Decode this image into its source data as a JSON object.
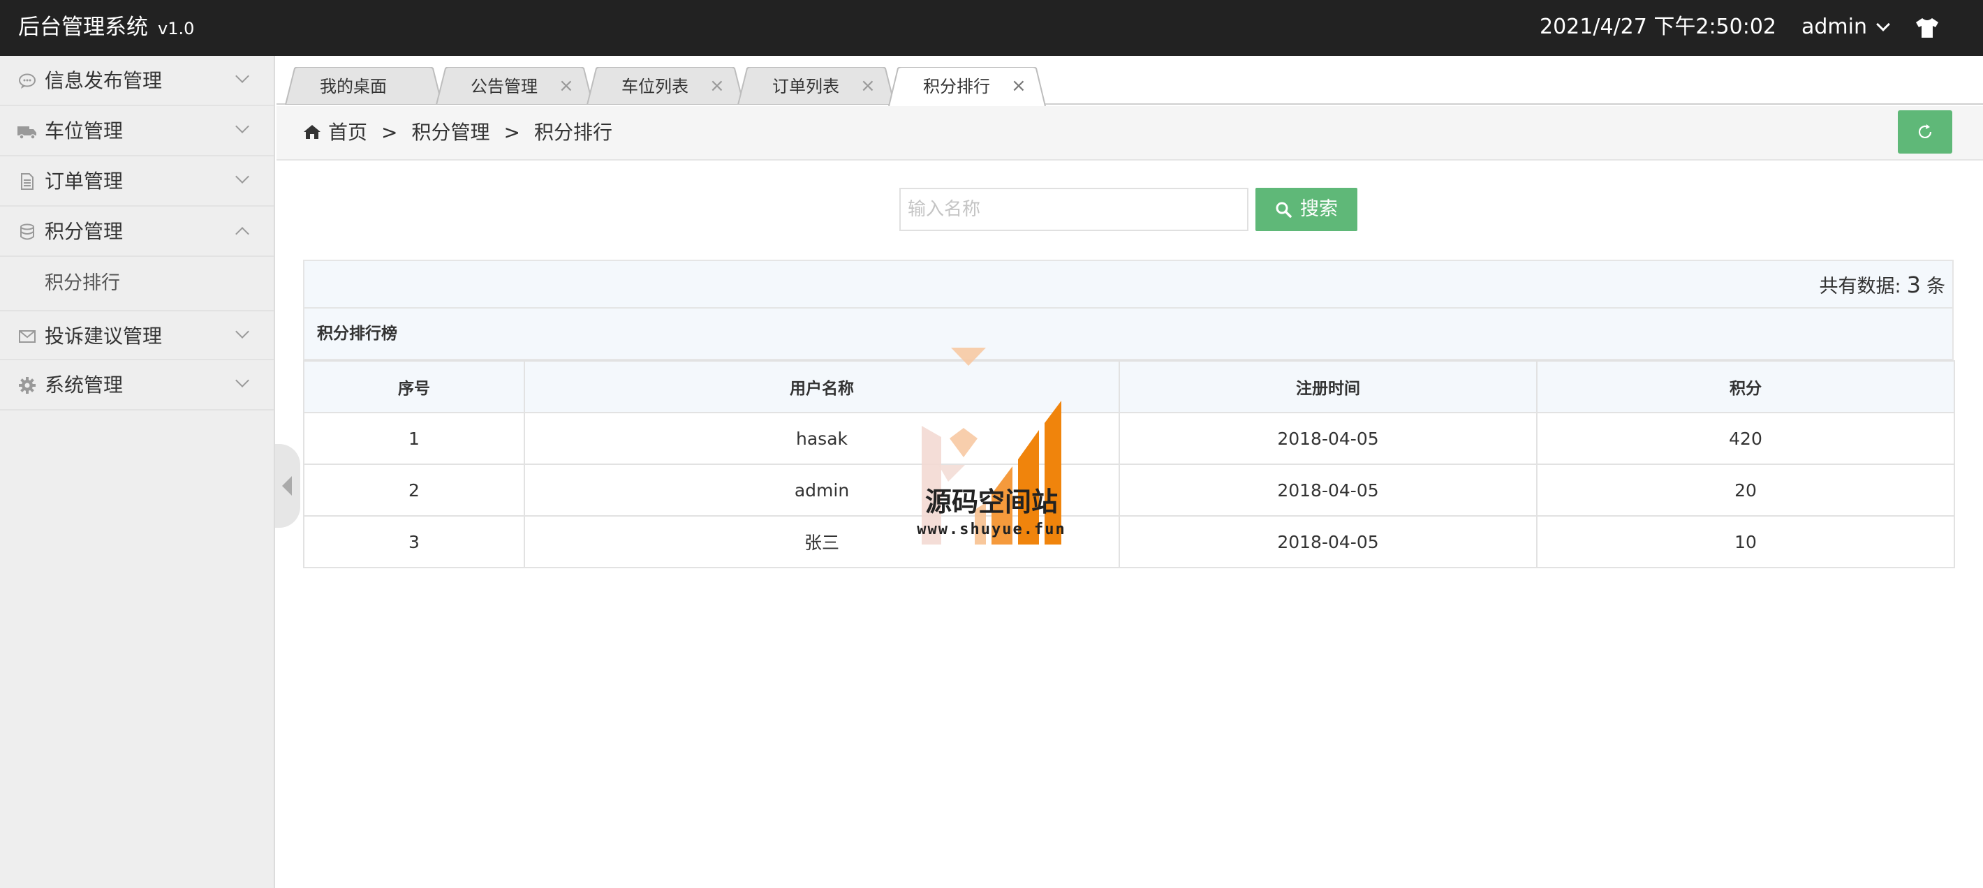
{
  "header": {
    "app_title": "后台管理系统",
    "version": "v1.0",
    "datetime": "2021/4/27 下午2:50:02",
    "user": "admin",
    "theme_icon": "shirt-icon"
  },
  "sidebar": {
    "items": [
      {
        "label": "信息发布管理",
        "icon": "chat-bubble-icon",
        "expanded": false
      },
      {
        "label": "车位管理",
        "icon": "truck-icon",
        "expanded": false
      },
      {
        "label": "订单管理",
        "icon": "document-icon",
        "expanded": false
      },
      {
        "label": "积分管理",
        "icon": "database-icon",
        "expanded": true,
        "children": [
          {
            "label": "积分排行"
          }
        ]
      },
      {
        "label": "投诉建议管理",
        "icon": "envelope-icon",
        "expanded": false
      },
      {
        "label": "系统管理",
        "icon": "gear-icon",
        "expanded": false
      }
    ]
  },
  "tabs": [
    {
      "label": "我的桌面",
      "closable": false
    },
    {
      "label": "公告管理",
      "closable": true
    },
    {
      "label": "车位列表",
      "closable": true
    },
    {
      "label": "订单列表",
      "closable": true
    },
    {
      "label": "积分排行",
      "closable": true,
      "active": true
    }
  ],
  "breadcrumb": {
    "items": [
      "首页",
      "积分管理",
      "积分排行"
    ],
    "separator": ">"
  },
  "search": {
    "placeholder": "输入名称",
    "value": "",
    "button_label": "搜索"
  },
  "summary": {
    "prefix": "共有数据:",
    "count": "3",
    "suffix": "条"
  },
  "table": {
    "title": "积分排行榜",
    "columns": [
      "序号",
      "用户名称",
      "注册时间",
      "积分"
    ],
    "rows": [
      [
        "1",
        "hasak",
        "2018-04-05",
        "420"
      ],
      [
        "2",
        "admin",
        "2018-04-05",
        "20"
      ],
      [
        "3",
        "张三",
        "2018-04-05",
        "10"
      ]
    ]
  },
  "watermark": {
    "title": "源码空间站",
    "url": "www.shuyue.fun"
  },
  "colors": {
    "topbar": "#222222",
    "accent_green": "#5fb878",
    "sidebar_bg": "#eeeeee",
    "table_header_bg": "#f4f8fc"
  }
}
